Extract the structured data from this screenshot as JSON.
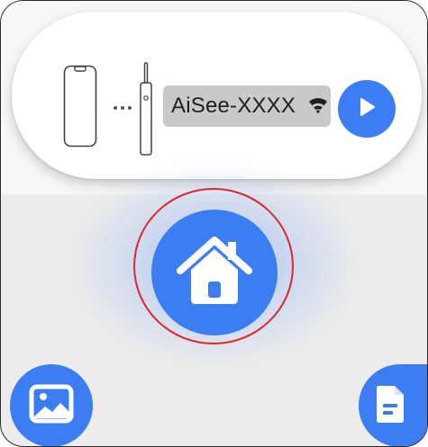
{
  "connection": {
    "device_name": "AiSee-XXXX",
    "icons": [
      "phone-icon",
      "dots-icon",
      "toothbrush-icon",
      "wifi-icon",
      "play-icon"
    ]
  },
  "navigation": {
    "home_icon": "home-icon",
    "gallery_icon": "gallery-icon",
    "document_icon": "document-icon"
  },
  "colors": {
    "accent": "#3d7df2",
    "highlight_ring": "#e0262e",
    "chip_background": "#c9c9c9",
    "background": "#ececec"
  }
}
